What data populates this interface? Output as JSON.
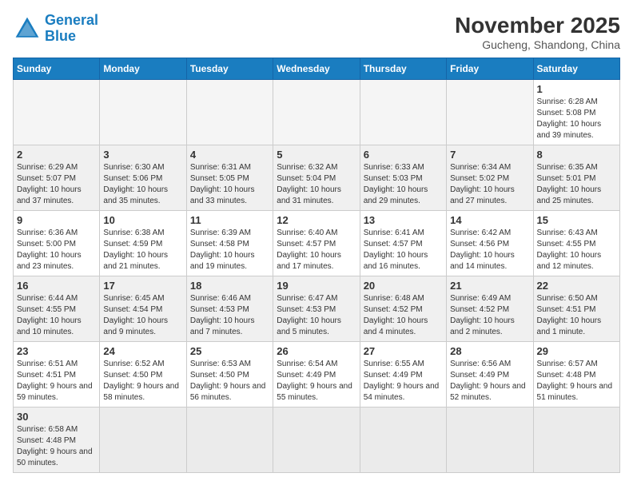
{
  "logo": {
    "text_general": "General",
    "text_blue": "Blue"
  },
  "title": {
    "month_year": "November 2025",
    "location": "Gucheng, Shandong, China"
  },
  "weekdays": [
    "Sunday",
    "Monday",
    "Tuesday",
    "Wednesday",
    "Thursday",
    "Friday",
    "Saturday"
  ],
  "rows": [
    {
      "shaded": false,
      "cells": [
        {
          "day": "",
          "info": ""
        },
        {
          "day": "",
          "info": ""
        },
        {
          "day": "",
          "info": ""
        },
        {
          "day": "",
          "info": ""
        },
        {
          "day": "",
          "info": ""
        },
        {
          "day": "",
          "info": ""
        },
        {
          "day": "1",
          "info": "Sunrise: 6:28 AM\nSunset: 5:08 PM\nDaylight: 10 hours and 39 minutes."
        }
      ]
    },
    {
      "shaded": true,
      "cells": [
        {
          "day": "2",
          "info": "Sunrise: 6:29 AM\nSunset: 5:07 PM\nDaylight: 10 hours and 37 minutes."
        },
        {
          "day": "3",
          "info": "Sunrise: 6:30 AM\nSunset: 5:06 PM\nDaylight: 10 hours and 35 minutes."
        },
        {
          "day": "4",
          "info": "Sunrise: 6:31 AM\nSunset: 5:05 PM\nDaylight: 10 hours and 33 minutes."
        },
        {
          "day": "5",
          "info": "Sunrise: 6:32 AM\nSunset: 5:04 PM\nDaylight: 10 hours and 31 minutes."
        },
        {
          "day": "6",
          "info": "Sunrise: 6:33 AM\nSunset: 5:03 PM\nDaylight: 10 hours and 29 minutes."
        },
        {
          "day": "7",
          "info": "Sunrise: 6:34 AM\nSunset: 5:02 PM\nDaylight: 10 hours and 27 minutes."
        },
        {
          "day": "8",
          "info": "Sunrise: 6:35 AM\nSunset: 5:01 PM\nDaylight: 10 hours and 25 minutes."
        }
      ]
    },
    {
      "shaded": false,
      "cells": [
        {
          "day": "9",
          "info": "Sunrise: 6:36 AM\nSunset: 5:00 PM\nDaylight: 10 hours and 23 minutes."
        },
        {
          "day": "10",
          "info": "Sunrise: 6:38 AM\nSunset: 4:59 PM\nDaylight: 10 hours and 21 minutes."
        },
        {
          "day": "11",
          "info": "Sunrise: 6:39 AM\nSunset: 4:58 PM\nDaylight: 10 hours and 19 minutes."
        },
        {
          "day": "12",
          "info": "Sunrise: 6:40 AM\nSunset: 4:57 PM\nDaylight: 10 hours and 17 minutes."
        },
        {
          "day": "13",
          "info": "Sunrise: 6:41 AM\nSunset: 4:57 PM\nDaylight: 10 hours and 16 minutes."
        },
        {
          "day": "14",
          "info": "Sunrise: 6:42 AM\nSunset: 4:56 PM\nDaylight: 10 hours and 14 minutes."
        },
        {
          "day": "15",
          "info": "Sunrise: 6:43 AM\nSunset: 4:55 PM\nDaylight: 10 hours and 12 minutes."
        }
      ]
    },
    {
      "shaded": true,
      "cells": [
        {
          "day": "16",
          "info": "Sunrise: 6:44 AM\nSunset: 4:55 PM\nDaylight: 10 hours and 10 minutes."
        },
        {
          "day": "17",
          "info": "Sunrise: 6:45 AM\nSunset: 4:54 PM\nDaylight: 10 hours and 9 minutes."
        },
        {
          "day": "18",
          "info": "Sunrise: 6:46 AM\nSunset: 4:53 PM\nDaylight: 10 hours and 7 minutes."
        },
        {
          "day": "19",
          "info": "Sunrise: 6:47 AM\nSunset: 4:53 PM\nDaylight: 10 hours and 5 minutes."
        },
        {
          "day": "20",
          "info": "Sunrise: 6:48 AM\nSunset: 4:52 PM\nDaylight: 10 hours and 4 minutes."
        },
        {
          "day": "21",
          "info": "Sunrise: 6:49 AM\nSunset: 4:52 PM\nDaylight: 10 hours and 2 minutes."
        },
        {
          "day": "22",
          "info": "Sunrise: 6:50 AM\nSunset: 4:51 PM\nDaylight: 10 hours and 1 minute."
        }
      ]
    },
    {
      "shaded": false,
      "cells": [
        {
          "day": "23",
          "info": "Sunrise: 6:51 AM\nSunset: 4:51 PM\nDaylight: 9 hours and 59 minutes."
        },
        {
          "day": "24",
          "info": "Sunrise: 6:52 AM\nSunset: 4:50 PM\nDaylight: 9 hours and 58 minutes."
        },
        {
          "day": "25",
          "info": "Sunrise: 6:53 AM\nSunset: 4:50 PM\nDaylight: 9 hours and 56 minutes."
        },
        {
          "day": "26",
          "info": "Sunrise: 6:54 AM\nSunset: 4:49 PM\nDaylight: 9 hours and 55 minutes."
        },
        {
          "day": "27",
          "info": "Sunrise: 6:55 AM\nSunset: 4:49 PM\nDaylight: 9 hours and 54 minutes."
        },
        {
          "day": "28",
          "info": "Sunrise: 6:56 AM\nSunset: 4:49 PM\nDaylight: 9 hours and 52 minutes."
        },
        {
          "day": "29",
          "info": "Sunrise: 6:57 AM\nSunset: 4:48 PM\nDaylight: 9 hours and 51 minutes."
        }
      ]
    },
    {
      "shaded": true,
      "cells": [
        {
          "day": "30",
          "info": "Sunrise: 6:58 AM\nSunset: 4:48 PM\nDaylight: 9 hours and 50 minutes."
        },
        {
          "day": "",
          "info": ""
        },
        {
          "day": "",
          "info": ""
        },
        {
          "day": "",
          "info": ""
        },
        {
          "day": "",
          "info": ""
        },
        {
          "day": "",
          "info": ""
        },
        {
          "day": "",
          "info": ""
        }
      ]
    }
  ]
}
